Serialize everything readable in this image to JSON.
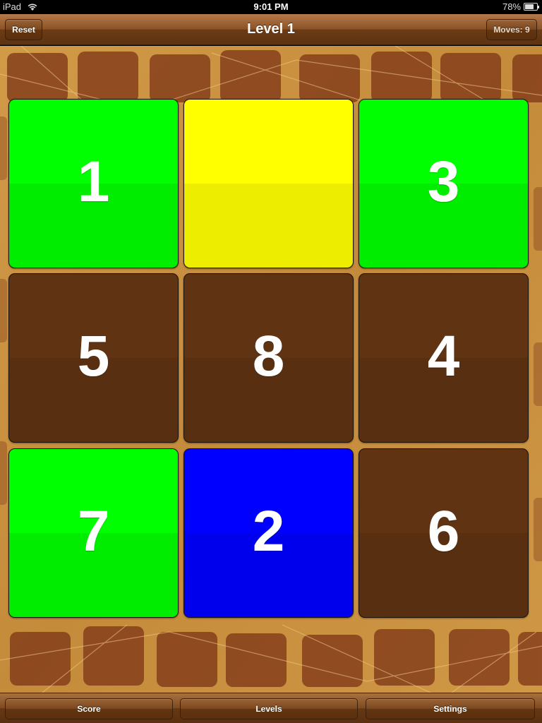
{
  "status_bar": {
    "carrier": "iPad",
    "time": "9:01 PM",
    "battery": "78%",
    "battery_level": 0.78
  },
  "top_bar": {
    "reset_label": "Reset",
    "title": "Level 1",
    "moves_label": "Moves: 9"
  },
  "tiles": [
    {
      "label": "1",
      "color": "#00ff00"
    },
    {
      "label": "",
      "color": "#ffff00"
    },
    {
      "label": "3",
      "color": "#00ff00"
    },
    {
      "label": "5",
      "color": "#603313"
    },
    {
      "label": "8",
      "color": "#603313"
    },
    {
      "label": "4",
      "color": "#603313"
    },
    {
      "label": "7",
      "color": "#00ff00"
    },
    {
      "label": "2",
      "color": "#0000ff"
    },
    {
      "label": "6",
      "color": "#603313"
    }
  ],
  "bottom_bar": {
    "score_label": "Score",
    "levels_label": "Levels",
    "settings_label": "Settings"
  },
  "colors": {
    "toolbar_brown": "#6b3b15",
    "board_tan": "#c8913f",
    "green": "#00ff00",
    "yellow": "#ffff00",
    "brown": "#603313",
    "blue": "#0000ff"
  }
}
